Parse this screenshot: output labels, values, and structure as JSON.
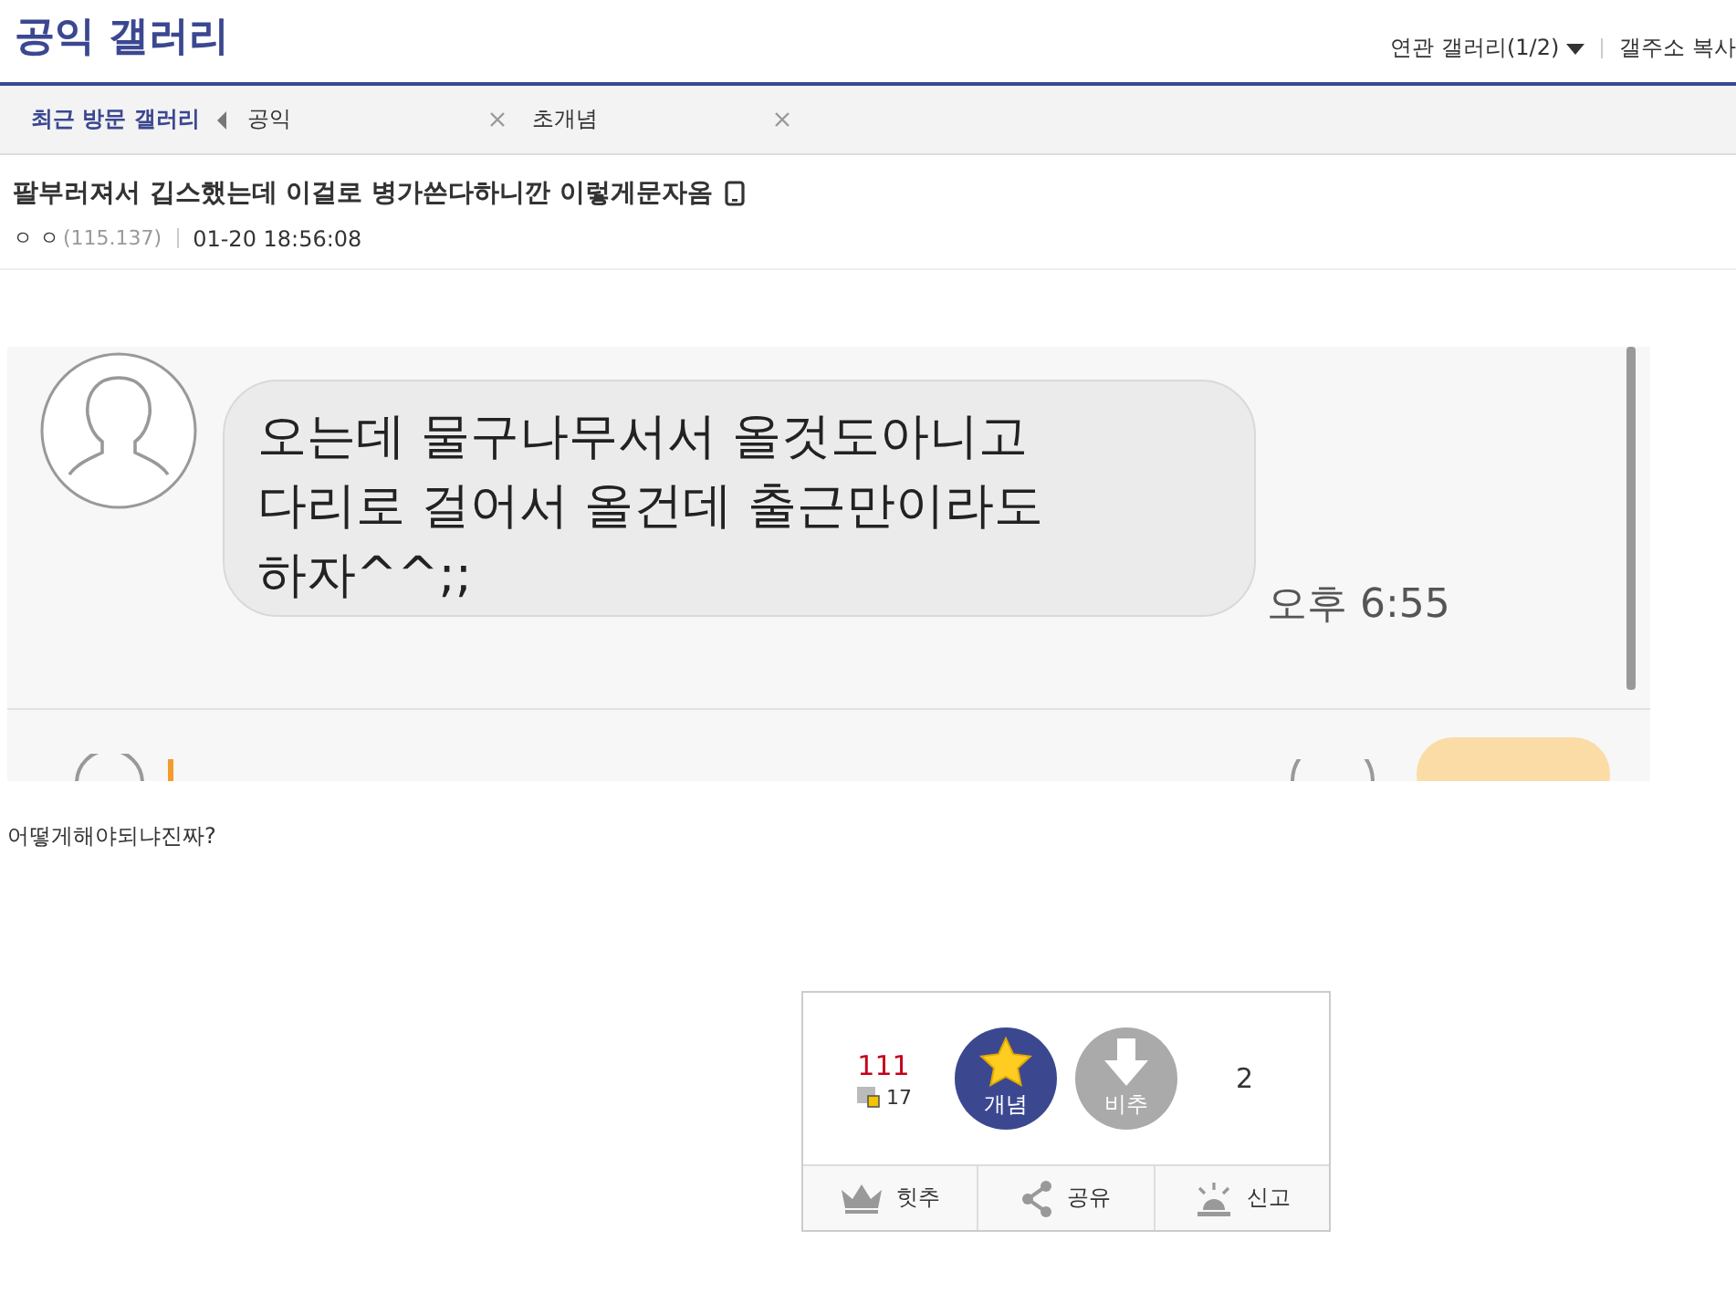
{
  "gallery_title": "공익 갤러리",
  "header_links": [
    {
      "label": "연관 갤러리(1/2)",
      "kind": "dropdown"
    },
    {
      "label": "갤주소 복사",
      "kind": "link"
    }
  ],
  "recent": {
    "label": "최근 방문 갤러리",
    "items": [
      {
        "name": "공익"
      },
      {
        "name": "초개념"
      }
    ]
  },
  "post": {
    "title": "팔부러져서 깁스했는데 이걸로 병가쓴다하니깐 이렇게문자옴",
    "author": "ㅇ ㅇ",
    "ip": "(115.137)",
    "date": "01-20 18:56:08"
  },
  "chat_image": {
    "message_lines": [
      "오는데 물구나무서서 올것도아니고",
      "다리로 걸어서 올건데 출근만이라도",
      "하자^^;;"
    ],
    "time": "오후 6:55"
  },
  "body": "어떻게해야되냐진짜?",
  "votes": {
    "up_count": "111",
    "fixed_count": "17",
    "up_label": "개념",
    "down_label": "비추",
    "down_count": "2"
  },
  "actions": [
    {
      "label": "힛추",
      "kind": "crown"
    },
    {
      "label": "공유",
      "kind": "share"
    },
    {
      "label": "신고",
      "kind": "siren"
    }
  ]
}
